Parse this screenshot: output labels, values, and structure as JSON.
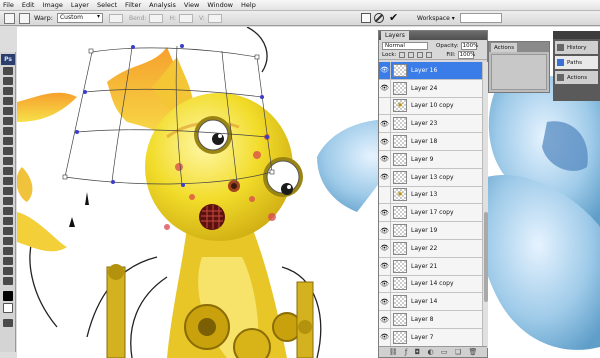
{
  "menu": [
    "File",
    "Edit",
    "Image",
    "Layer",
    "Select",
    "Filter",
    "Analysis",
    "View",
    "Window",
    "Help"
  ],
  "options": {
    "warp_label": "Warp:",
    "warp_value": "Custom",
    "bend_label": "Bend:",
    "h_label": "H:",
    "v_label": "V:",
    "workspace_label": "Workspace"
  },
  "toolbox": {
    "logo": "Ps"
  },
  "layers": {
    "tab_label": "Layers",
    "blend_mode": "Normal",
    "opacity_label": "Opacity:",
    "opacity_value": "100%",
    "lock_label": "Lock:",
    "fill_label": "Fill:",
    "fill_value": "100%",
    "items": [
      {
        "name": "Layer 16",
        "visible": true,
        "selected": true,
        "thumb": "checker"
      },
      {
        "name": "Layer 24",
        "visible": true,
        "selected": false,
        "thumb": "checker"
      },
      {
        "name": "Layer 10 copy",
        "visible": false,
        "selected": false,
        "thumb": "star"
      },
      {
        "name": "Layer 23",
        "visible": true,
        "selected": false,
        "thumb": "checker"
      },
      {
        "name": "Layer 18",
        "visible": true,
        "selected": false,
        "thumb": "checker"
      },
      {
        "name": "Layer 9",
        "visible": true,
        "selected": false,
        "thumb": "checker"
      },
      {
        "name": "Layer 13 copy",
        "visible": true,
        "selected": false,
        "thumb": "checker"
      },
      {
        "name": "Layer 13",
        "visible": false,
        "selected": false,
        "thumb": "star"
      },
      {
        "name": "Layer 17 copy",
        "visible": true,
        "selected": false,
        "thumb": "checker"
      },
      {
        "name": "Layer 19",
        "visible": true,
        "selected": false,
        "thumb": "checker"
      },
      {
        "name": "Layer 22",
        "visible": true,
        "selected": false,
        "thumb": "checker"
      },
      {
        "name": "Layer 21",
        "visible": true,
        "selected": false,
        "thumb": "checker"
      },
      {
        "name": "Layer 14 copy",
        "visible": true,
        "selected": false,
        "thumb": "checker"
      },
      {
        "name": "Layer 14",
        "visible": true,
        "selected": false,
        "thumb": "checker"
      },
      {
        "name": "Layer 8",
        "visible": true,
        "selected": false,
        "thumb": "checker"
      },
      {
        "name": "Layer 7",
        "visible": true,
        "selected": false,
        "thumb": "checker"
      }
    ]
  },
  "mini_panel": {
    "tab_actions": "Actions"
  },
  "dock": [
    "History",
    "Paths",
    "Actions"
  ],
  "colors": {
    "selected_layer": "#3a7ce8",
    "canvas_bg": "#ffffff",
    "panel_bg": "#d8d8d8"
  }
}
